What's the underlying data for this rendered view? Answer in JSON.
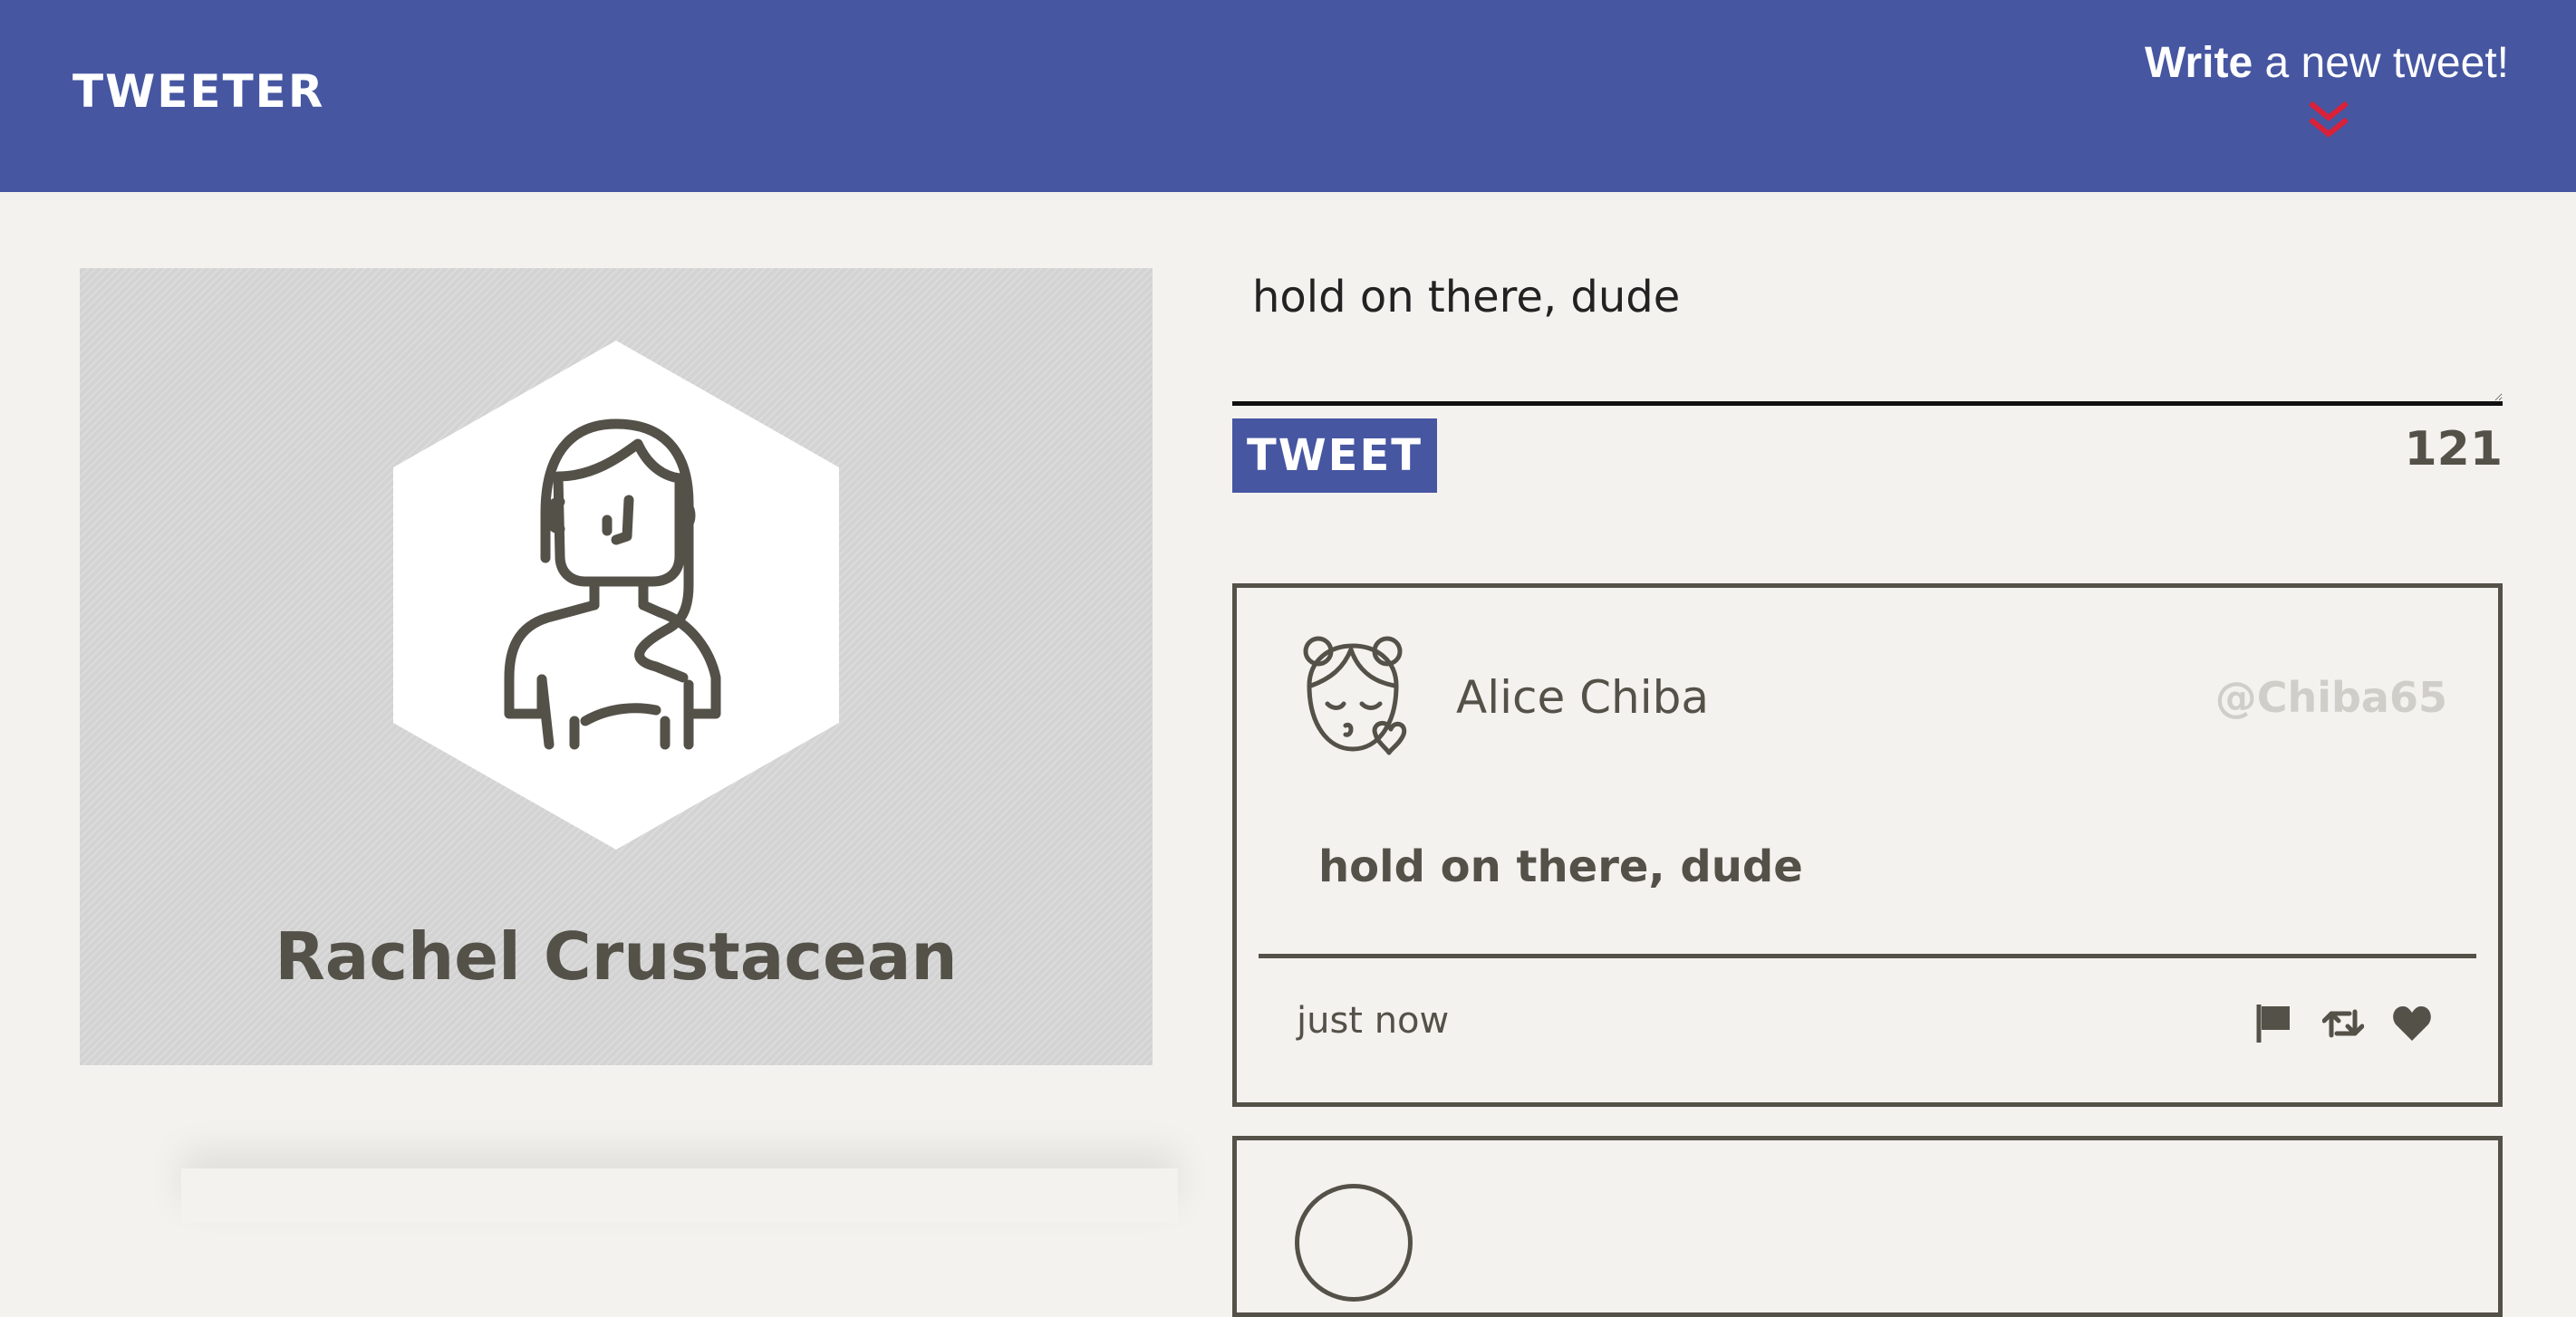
{
  "nav": {
    "logo": "TWEETER",
    "compose_strong": "Write",
    "compose_light": " a new tweet!",
    "chevron_icon": "double-chevron-down-icon",
    "chevron_color": "#d9213a",
    "background": "#4656a1"
  },
  "profile": {
    "name": "Rachel Crustacean",
    "avatar_icon": "woman-avatar-icon"
  },
  "compose": {
    "input_value": "hold on there, dude",
    "button_label": "TWEET",
    "char_counter": "121"
  },
  "tweets": [
    {
      "avatar_icon": "girl-kiss-avatar-icon",
      "author": "Alice Chiba",
      "handle": "@Chiba65",
      "body": "hold on there, dude",
      "time": "just now",
      "actions": [
        "flag-icon",
        "retweet-icon",
        "heart-icon"
      ]
    }
  ],
  "colors": {
    "accent": "#4656a1",
    "text": "#545149",
    "page": "#f4f2ee",
    "handle": "#d0cec9"
  }
}
